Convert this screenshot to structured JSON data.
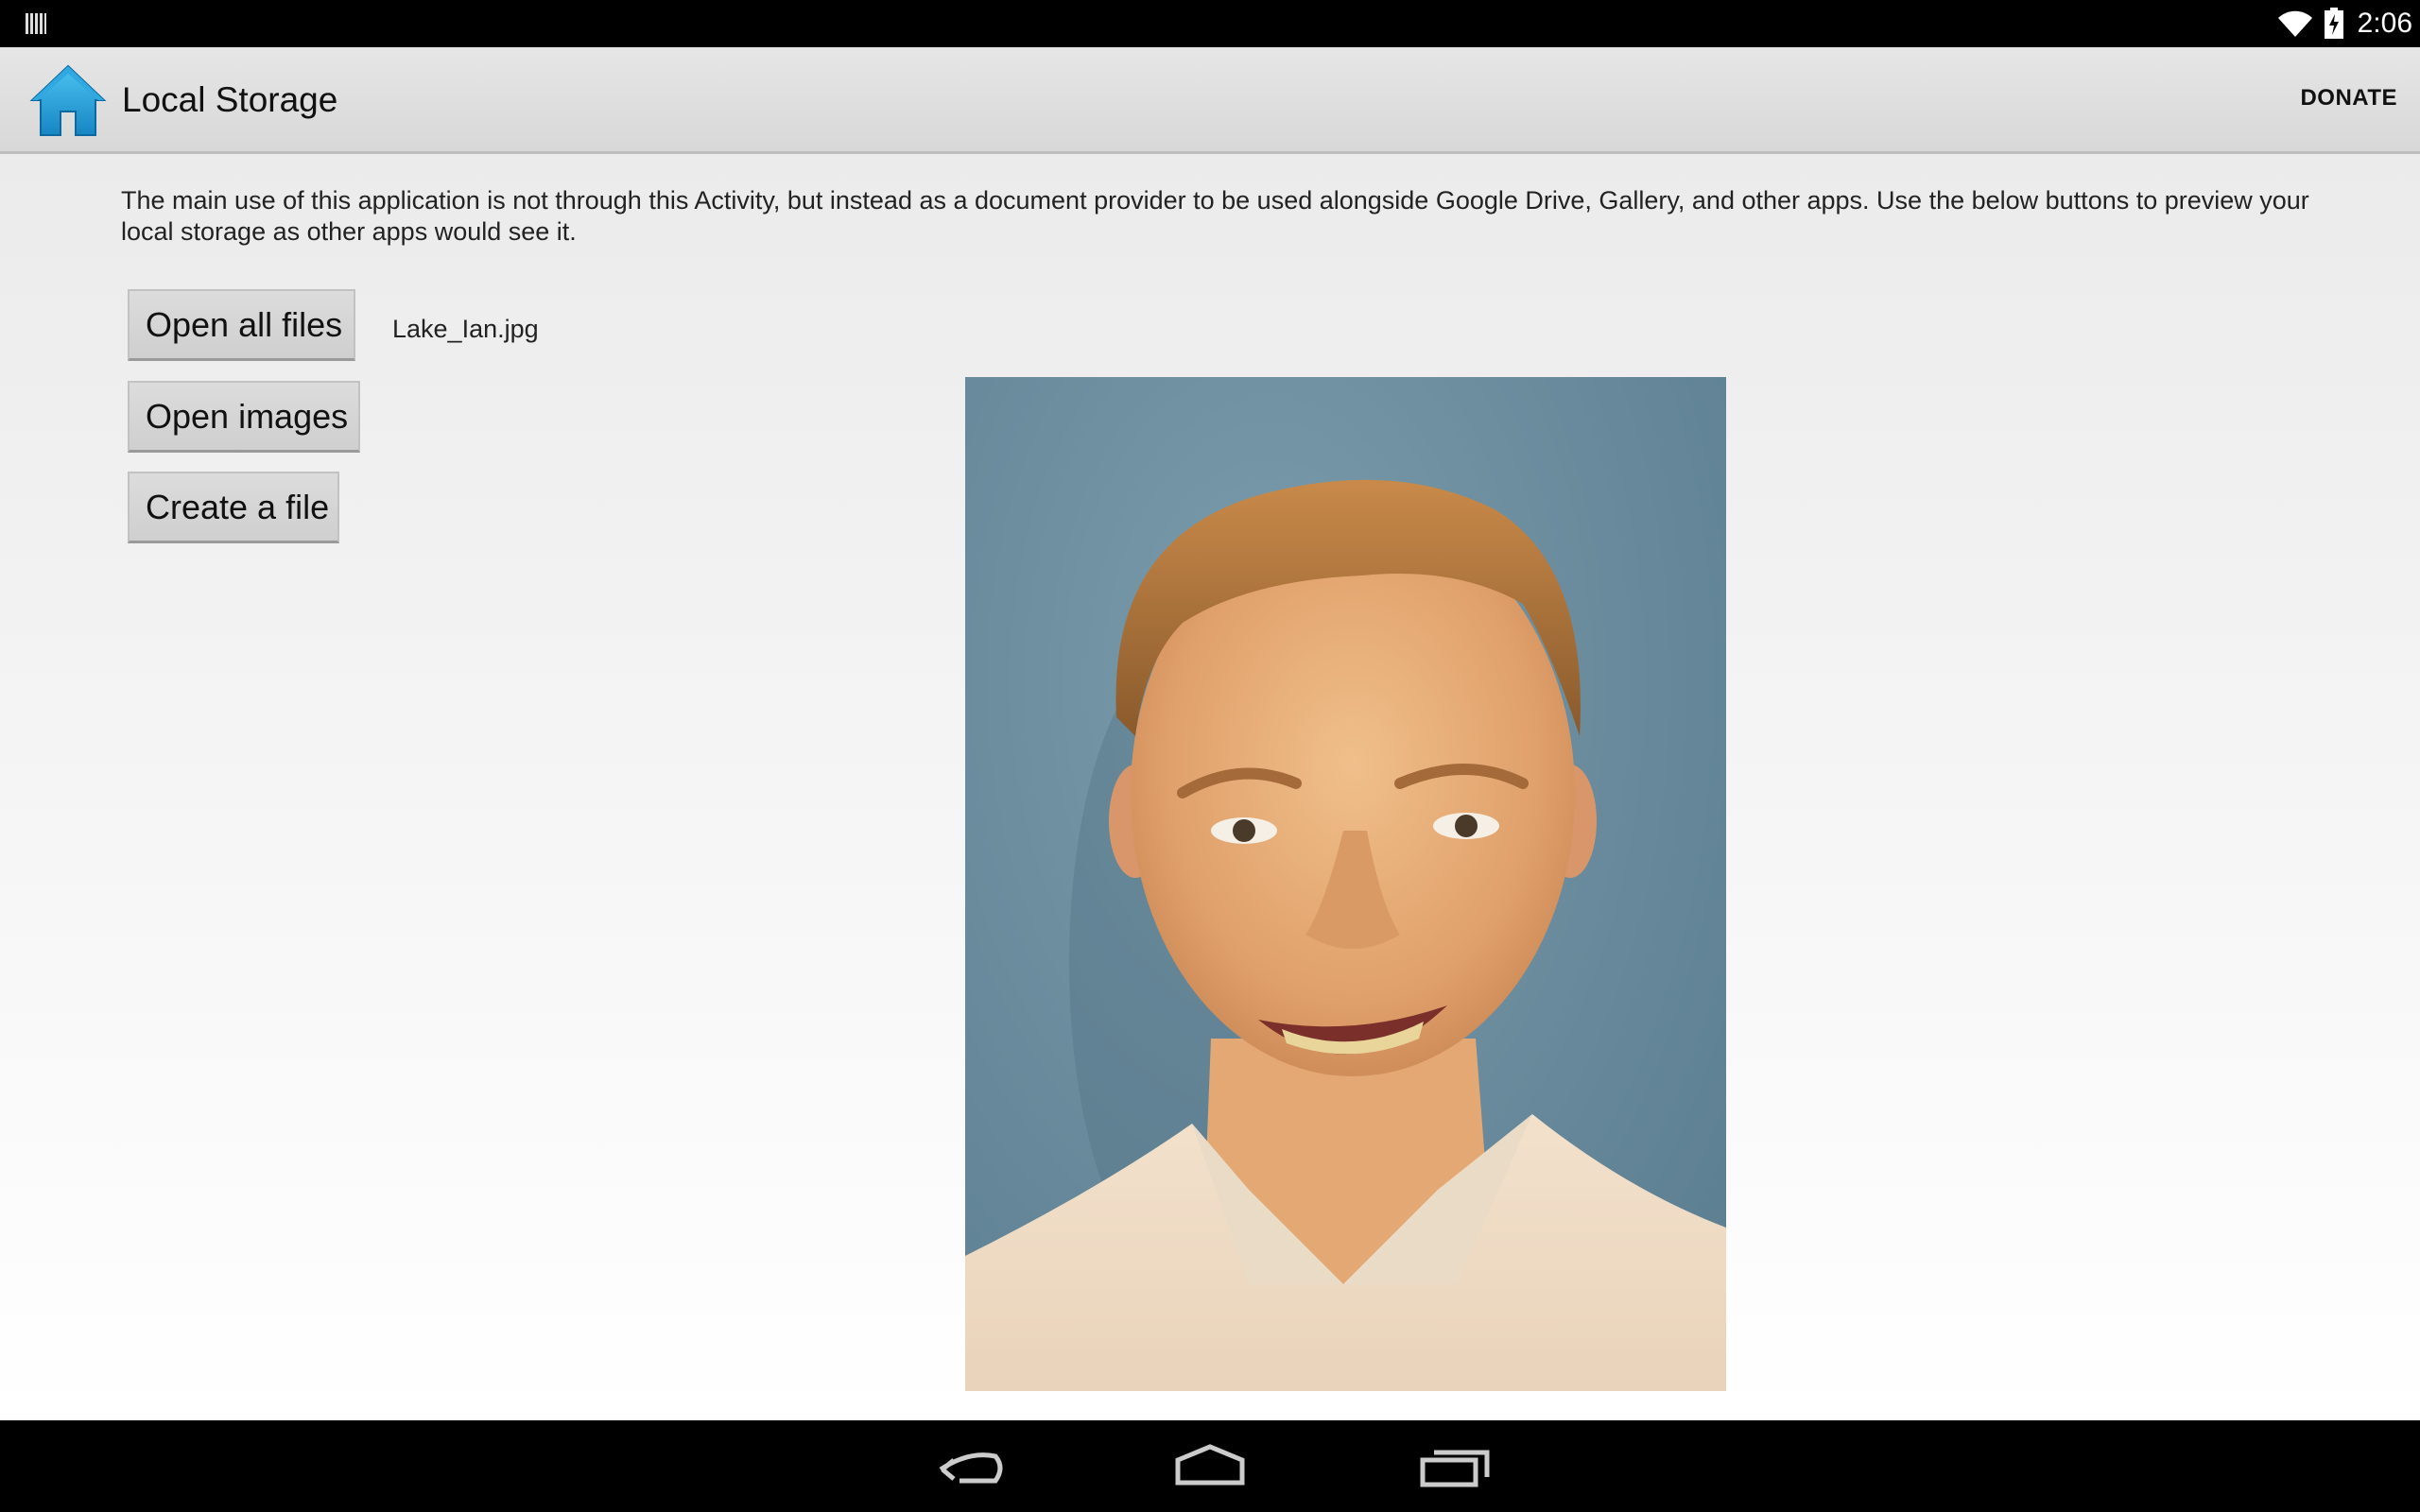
{
  "status_bar": {
    "time": "2:06",
    "icons": [
      "notification-icon",
      "wifi-icon",
      "battery-charging-icon"
    ]
  },
  "action_bar": {
    "title": "Local Storage",
    "action_label": "DONATE",
    "icon": "home-icon"
  },
  "content": {
    "intro_text": "The main use of this application is not through this Activity, but instead as a document provider to be used alongside Google Drive, Gallery, and other apps. Use the below buttons to preview your local storage as other apps would see it.",
    "buttons": {
      "open_all_files": "Open all files",
      "open_images": "Open images",
      "create_file": "Create a file"
    },
    "selected_file": "Lake_Ian.jpg",
    "preview_image": "portrait-photo"
  },
  "nav_bar": {
    "icons": [
      "back-icon",
      "home-nav-icon",
      "recent-apps-icon"
    ]
  }
}
